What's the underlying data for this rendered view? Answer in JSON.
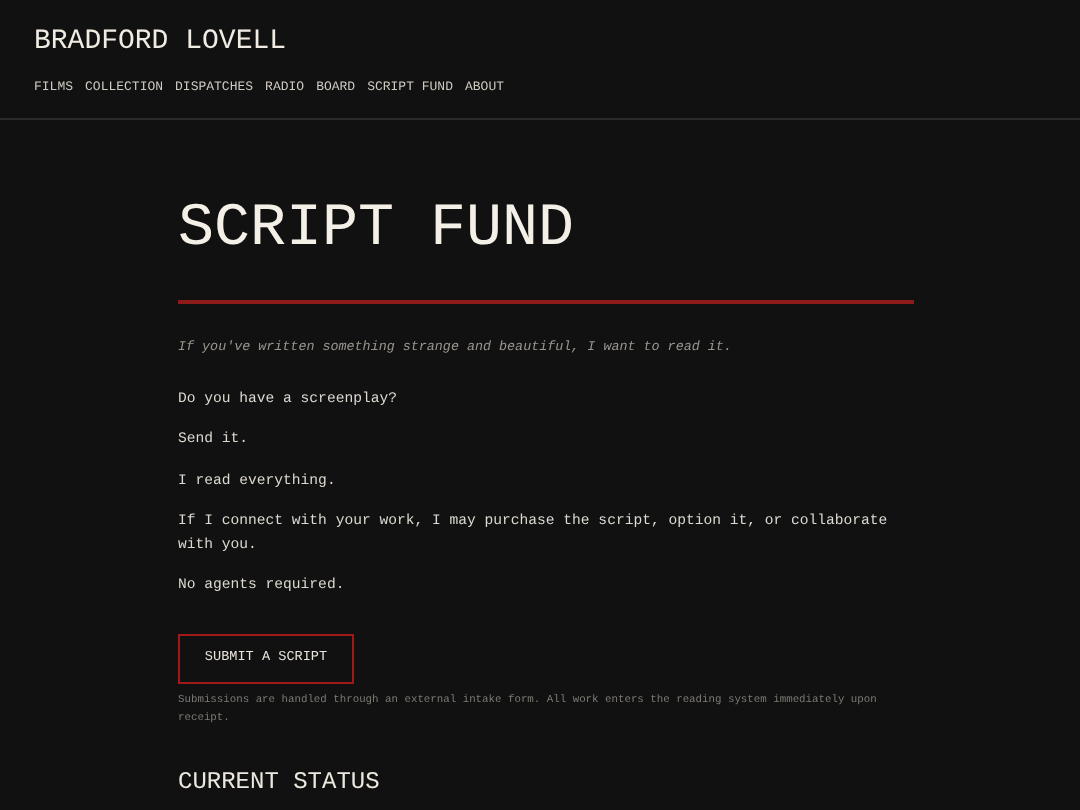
{
  "site": {
    "brand": "BRADFORD LOVELL",
    "nav": [
      {
        "label": "FILMS"
      },
      {
        "label": "COLLECTION"
      },
      {
        "label": "DISPATCHES"
      },
      {
        "label": "RADIO"
      },
      {
        "label": "BOARD"
      },
      {
        "label": "SCRIPT FUND"
      },
      {
        "label": "ABOUT"
      }
    ]
  },
  "page": {
    "title": "SCRIPT FUND",
    "lede": "If you've written something strange and beautiful, I want to read it.",
    "paragraphs": [
      "Do you have a screenplay?",
      "Send it.",
      "I read everything.",
      "If I connect with your work, I may purchase the script, option it, or collaborate with you.",
      "No agents required."
    ],
    "button": "SUBMIT A SCRIPT",
    "note": "Submissions are handled through an external intake form. All work enters the reading system immediately upon receipt.",
    "section_heading": "CURRENT STATUS"
  }
}
